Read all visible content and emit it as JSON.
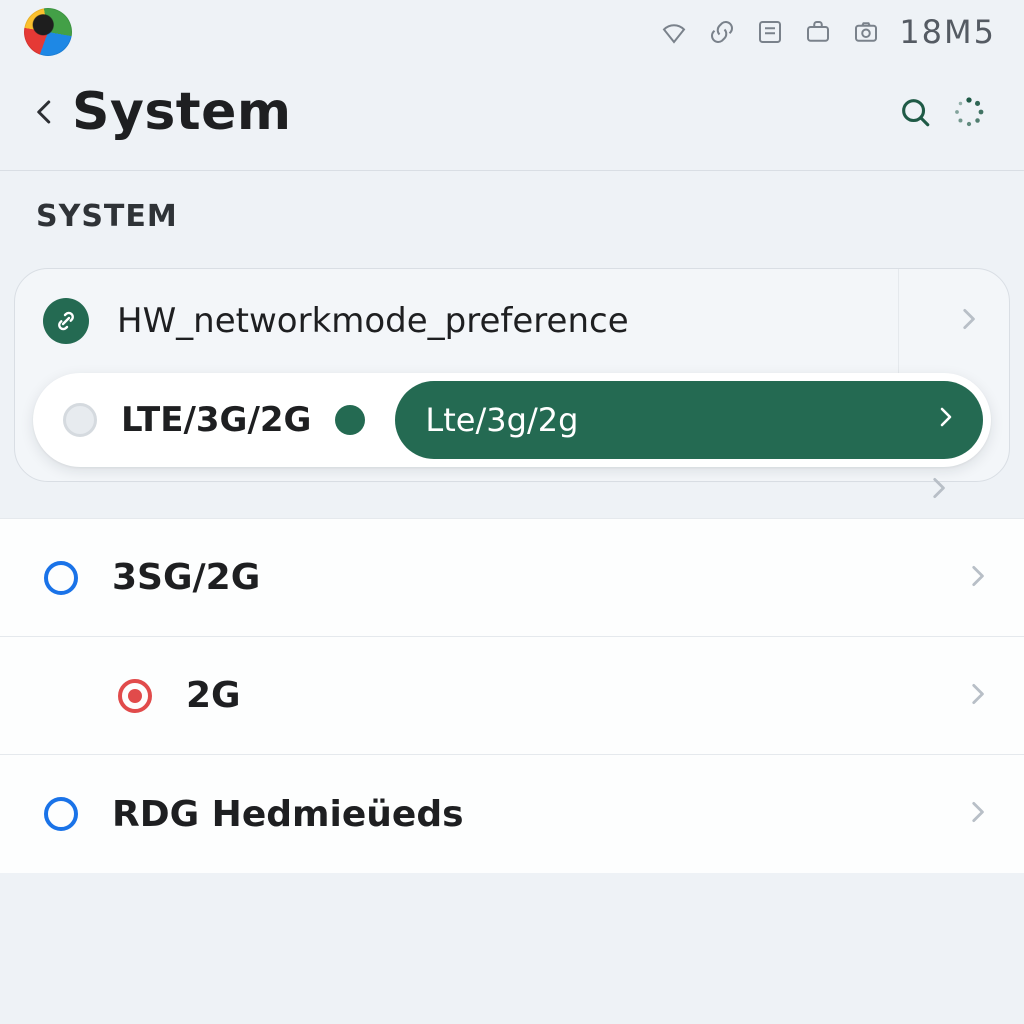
{
  "status": {
    "clock": "18M5",
    "icons": [
      "wifi-icon",
      "link-icon",
      "card-icon",
      "briefcase-icon",
      "camera-icon"
    ]
  },
  "header": {
    "title": "System"
  },
  "section": {
    "label": "SYSTEM"
  },
  "group": {
    "pref_title": "HW_networkmode_preference",
    "pill": {
      "left_label": "LTE/3G/2G",
      "cap_label": "Lte/3g/2g"
    }
  },
  "options": [
    {
      "label": "3SG/2G",
      "ring": "blue",
      "indent": false
    },
    {
      "label": "2G",
      "ring": "red",
      "indent": true
    },
    {
      "label": "RDG Hedmieüeds",
      "ring": "blue",
      "indent": false
    }
  ],
  "colors": {
    "accent_green": "#246a52",
    "accent_blue": "#1a73e8",
    "accent_red": "#e14b4b"
  }
}
